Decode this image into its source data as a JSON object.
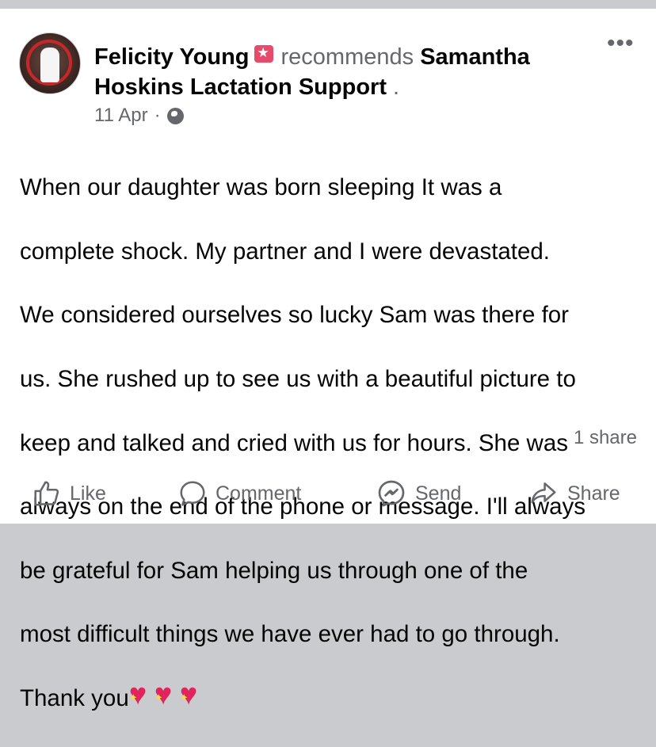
{
  "post": {
    "author": "Felicity Young",
    "action": "recommends",
    "page_name": "Samantha Hoskins Lactation Support",
    "page_suffix": ".",
    "date": "11 Apr",
    "separator": "·",
    "body_lines": [
      "When our daughter was born sleeping It was a",
      "complete shock. My partner and I were devastated.",
      "We considered ourselves so lucky Sam was there for",
      "us. She rushed up to see us with a beautiful picture to",
      "keep and talked and cried with us for hours. She was",
      "always on the end of the phone or message. I'll always",
      "be grateful for Sam helping us through one of the",
      "most difficult things we have ever had to go through.",
      "Thank you"
    ],
    "emoji_count": 3,
    "shares": "1 share"
  },
  "actions": {
    "like": "Like",
    "comment": "Comment",
    "send": "Send",
    "share": "Share"
  },
  "icons": {
    "more": "more-options-icon",
    "privacy": "globe-icon",
    "badge": "recommendation-star-icon",
    "emoji": "sparkling-heart-icon"
  },
  "colors": {
    "text": "#050505",
    "secondary": "#65676b",
    "badge": "#e84a6a",
    "heart": "#e0245e",
    "background": "#c9cbce"
  }
}
